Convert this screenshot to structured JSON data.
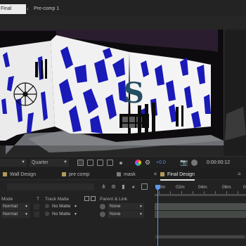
{
  "comp_tabs": [
    {
      "label": "Final Design",
      "active": true
    },
    {
      "label": "Pre-comp 1",
      "active": false
    }
  ],
  "viewer": {
    "sign_letter": "S"
  },
  "viewer_controls": {
    "magnification": "",
    "resolution": "Quarter",
    "exposure": "+0.0",
    "timecode": "0:00:00:12",
    "accent_color": "#4f8fe6"
  },
  "timeline": {
    "tabs": [
      {
        "label": "Wall Design",
        "color": "#b59b58"
      },
      {
        "label": "pre comp",
        "color": "#b59b58"
      },
      {
        "label": "mask",
        "color": "#7b7b7b"
      },
      {
        "label": "Final Design",
        "color": "#b59b58",
        "active": true
      }
    ],
    "headers": {
      "mode": "Mode",
      "t": "T",
      "track_matte": "Track Matte",
      "parent_link": "Parent & Link"
    },
    "ruler_labels": [
      "0m",
      "02m",
      "04m",
      "06m",
      "08m"
    ],
    "layers": [
      {
        "mode": "Normal",
        "matte": "No Matte",
        "parent": "None"
      },
      {
        "mode": "Normal",
        "matte": "No Matte",
        "parent": "None"
      }
    ],
    "playhead_color": "#5d98ee"
  }
}
